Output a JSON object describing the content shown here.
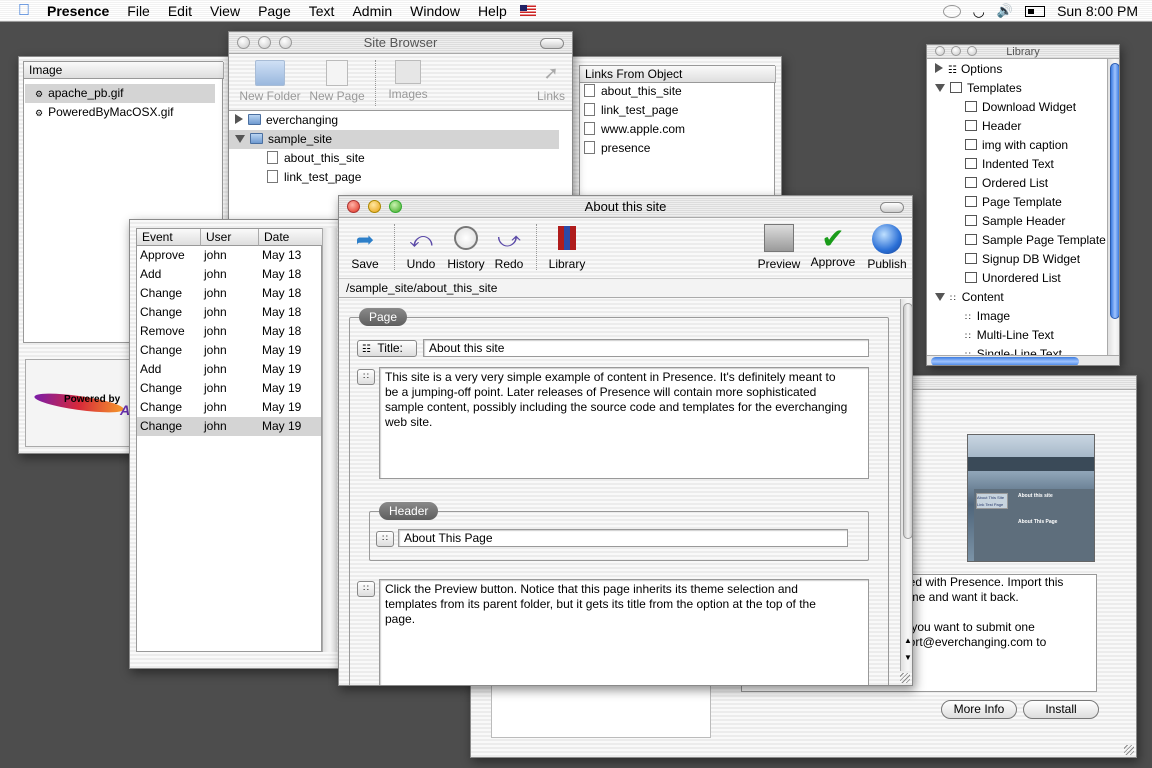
{
  "menubar": {
    "app": "Presence",
    "menus": [
      "File",
      "Edit",
      "View",
      "Page",
      "Text",
      "Admin",
      "Window",
      "Help"
    ],
    "clock": "Sun 8:00 PM"
  },
  "image_window": {
    "header": "Image",
    "files": [
      "apache_pb.gif",
      "PoweredByMacOSX.gif"
    ],
    "preview_text": "Powered by",
    "preview_suffix": "AP"
  },
  "site_browser": {
    "title": "Site Browser",
    "toolbar": [
      "New Folder",
      "New Page",
      "Images",
      "Links"
    ],
    "tree": [
      {
        "label": "everchanging",
        "type": "folder",
        "open": false
      },
      {
        "label": "sample_site",
        "type": "folder",
        "open": true
      },
      {
        "label": "about_this_site",
        "type": "file"
      },
      {
        "label": "link_test_page",
        "type": "file"
      }
    ]
  },
  "links_panel": {
    "header": "Links From Object",
    "items": [
      "about_this_site",
      "link_test_page",
      "www.apple.com",
      "presence"
    ]
  },
  "history": {
    "columns": [
      "Event",
      "User",
      "Date"
    ],
    "rows": [
      [
        "Approve",
        "john",
        "May 13"
      ],
      [
        "Add",
        "john",
        "May 18"
      ],
      [
        "Change",
        "john",
        "May 18"
      ],
      [
        "Change",
        "john",
        "May 18"
      ],
      [
        "Remove",
        "john",
        "May 18"
      ],
      [
        "Change",
        "john",
        "May 19"
      ],
      [
        "Add",
        "john",
        "May 19"
      ],
      [
        "Change",
        "john",
        "May 19"
      ],
      [
        "Change",
        "john",
        "May 19"
      ],
      [
        "Change",
        "john",
        "May 19"
      ]
    ]
  },
  "library": {
    "title": "Library",
    "items": [
      {
        "label": "Options",
        "kind": "cat",
        "tri": "r"
      },
      {
        "label": "Templates",
        "kind": "cat",
        "tri": "d"
      },
      {
        "label": "Download Widget",
        "kind": "item"
      },
      {
        "label": "Header",
        "kind": "item"
      },
      {
        "label": "img with caption",
        "kind": "item"
      },
      {
        "label": "Indented Text",
        "kind": "item"
      },
      {
        "label": "Ordered List",
        "kind": "item"
      },
      {
        "label": "Page Template",
        "kind": "item"
      },
      {
        "label": "Sample Header",
        "kind": "item"
      },
      {
        "label": "Sample Page Template",
        "kind": "item"
      },
      {
        "label": "Signup DB Widget",
        "kind": "item"
      },
      {
        "label": "Unordered List",
        "kind": "item"
      },
      {
        "label": "Content",
        "kind": "cat",
        "tri": "d"
      },
      {
        "label": "Image",
        "kind": "item"
      },
      {
        "label": "Multi-Line Text",
        "kind": "item"
      },
      {
        "label": "Single-Line Text",
        "kind": "item"
      }
    ]
  },
  "installer": {
    "text_lines": [
      "ded with Presence. Import this",
      "eme and want it back.",
      "",
      "if you want to submit one",
      "port@everchanging.com to"
    ],
    "buttons": [
      "More Info",
      "Install"
    ],
    "thumb_heading": "About this site",
    "thumb_subheading": "About This Page",
    "thumb_links": [
      "About This Site",
      "Link Test Page"
    ]
  },
  "editor": {
    "title": "About this site",
    "toolbar_left": [
      "Save",
      "Undo",
      "History",
      "Redo",
      "Library"
    ],
    "toolbar_right": [
      "Preview",
      "Approve",
      "Publish"
    ],
    "path": "/sample_site/about_this_site",
    "page_group": "Page",
    "title_label": "Title:",
    "title_value": "About this site",
    "body_text": "This site is a very very simple example of content in Presence. It's definitely meant to be a jumping-off point. Later releases of Presence will contain more sophisticated sample content, possibly including the source code and templates for the everchanging web site.",
    "header_group": "Header",
    "header_value": "About This Page",
    "second_text": "Click the Preview button. Notice that this page inherits its theme selection and templates from its parent folder, but it gets its title from the option at the top of the page."
  }
}
